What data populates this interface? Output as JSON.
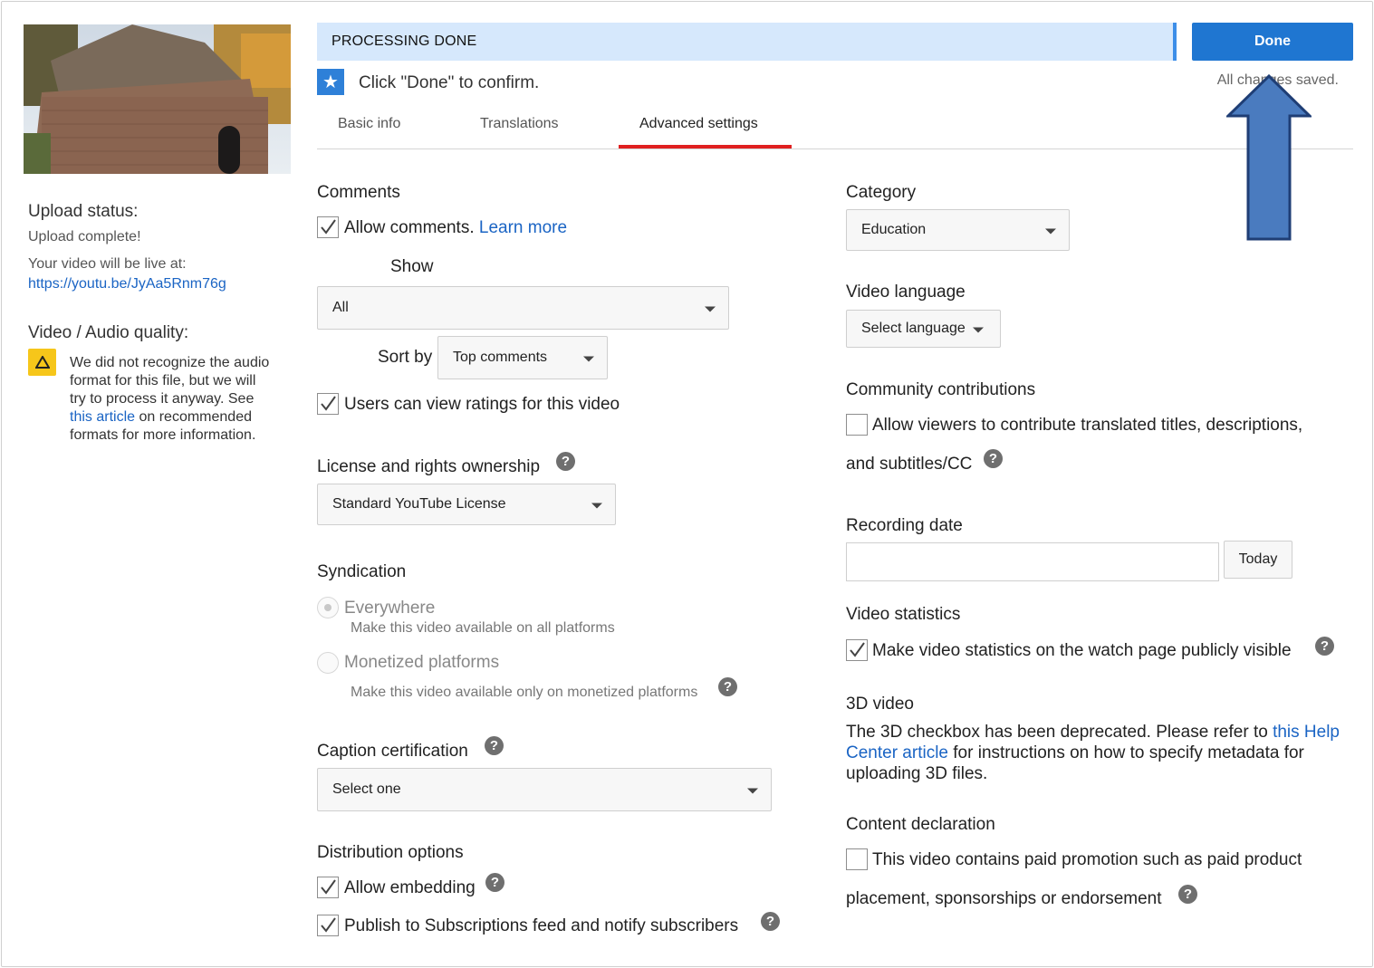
{
  "sidebar": {
    "thumbnail_alt": "video-thumbnail",
    "upload_status_title": "Upload status:",
    "upload_status_value": "Upload complete!",
    "live_at_label": "Your video will be live at:",
    "live_url": "https://youtu.be/JyAa5Rnm76g",
    "quality_title": "Video / Audio quality:",
    "warning_pre": "We did not recognize the audio format for this file, but we will try to process it anyway. See",
    "warning_link": "this article",
    "warning_post": "on recommended formats for more information."
  },
  "header": {
    "processing_text": "PROCESSING DONE",
    "done_label": "Done",
    "saved_text": "All changes saved.",
    "confirm_text": "Click \"Done\" to confirm."
  },
  "tabs": [
    {
      "label": "Basic info",
      "active": false
    },
    {
      "label": "Translations",
      "active": false
    },
    {
      "label": "Advanced settings",
      "active": true
    }
  ],
  "comments": {
    "title": "Comments",
    "allow_label": "Allow comments.",
    "learn_more": "Learn more",
    "allow_checked": true,
    "show_label": "Show",
    "show_value": "All",
    "sort_label": "Sort by",
    "sort_value": "Top comments",
    "ratings_label": "Users can view ratings for this video",
    "ratings_checked": true
  },
  "license": {
    "title": "License and rights ownership",
    "value": "Standard YouTube License"
  },
  "syndication": {
    "title": "Syndication",
    "everywhere_label": "Everywhere",
    "everywhere_desc": "Make this video available on all platforms",
    "monetized_label": "Monetized platforms",
    "monetized_desc": "Make this video available only on monetized platforms"
  },
  "caption": {
    "title": "Caption certification",
    "value": "Select one"
  },
  "distribution": {
    "title": "Distribution options",
    "embed_label": "Allow embedding",
    "embed_checked": true,
    "publish_label": "Publish to Subscriptions feed and notify subscribers",
    "publish_checked": true
  },
  "category": {
    "title": "Category",
    "value": "Education"
  },
  "video_language": {
    "title": "Video language",
    "value": "Select language"
  },
  "community": {
    "title": "Community contributions",
    "line1": "Allow viewers to contribute translated titles, descriptions,",
    "line2": "and subtitles/CC",
    "checked": false
  },
  "recording": {
    "title": "Recording date",
    "value": "",
    "today_label": "Today"
  },
  "statistics": {
    "title": "Video statistics",
    "label": "Make video statistics on the watch page publicly visible",
    "checked": true
  },
  "video3d": {
    "title": "3D video",
    "text_pre": "The 3D checkbox has been deprecated. Please refer to",
    "link_1": "this Help",
    "link_2": "Center article",
    "text_post_1": "for instructions on how to specify metadata for",
    "text_post_2": "uploading 3D files."
  },
  "content_declaration": {
    "title": "Content declaration",
    "line1": "This video contains paid promotion such as paid product",
    "line2": "placement, sponsorships or endorsement",
    "checked": false
  },
  "help_glyph": "?",
  "colors": {
    "accent": "#1f76d1",
    "processing_bg": "#d6e8fc",
    "tab_active": "#e02020",
    "link": "#1a64c4",
    "warning": "#f6c61a",
    "annotation_arrow": "#4a7bbf"
  }
}
